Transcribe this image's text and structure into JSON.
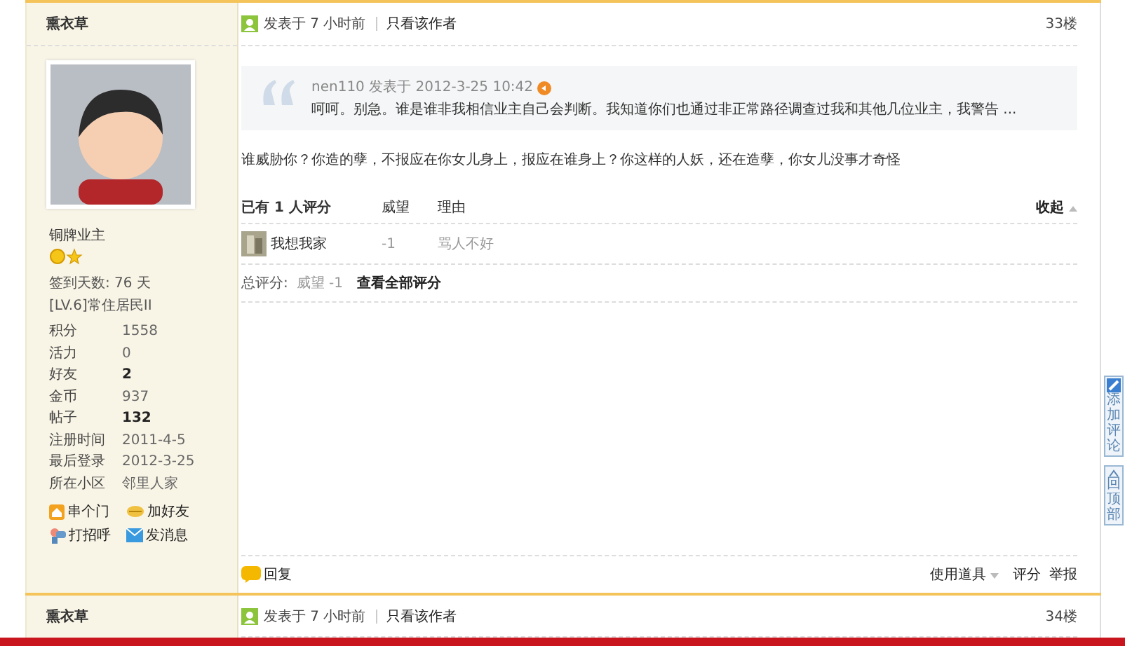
{
  "posts": [
    {
      "author": "熏衣草",
      "rank": "铜牌业主",
      "checkin": "签到天数: 76 天",
      "level": "[LV.6]常住居民II",
      "stats": [
        {
          "label": "积分",
          "value": "1558",
          "bold": false
        },
        {
          "label": "活力",
          "value": "0",
          "bold": false
        },
        {
          "label": "好友",
          "value": "2",
          "bold": true
        },
        {
          "label": "金币",
          "value": "937",
          "bold": false
        },
        {
          "label": "帖子",
          "value": "132",
          "bold": true
        },
        {
          "label": "注册时间",
          "value": "2011-4-5",
          "bold": false
        },
        {
          "label": "最后登录",
          "value": "2012-3-25",
          "bold": false
        },
        {
          "label": "所在小区",
          "value": "邻里人家",
          "bold": false
        }
      ],
      "actions": [
        {
          "kind": "home",
          "label": "串个门"
        },
        {
          "kind": "friend",
          "label": "加好友"
        },
        {
          "kind": "greet",
          "label": "打招呼"
        },
        {
          "kind": "mail",
          "label": "发消息"
        }
      ],
      "posted": "发表于 7 小时前",
      "author_only": "只看该作者",
      "floor": "33楼",
      "quote": {
        "meta": "nen110 发表于 2012-3-25 10:42",
        "text": "呵呵。别急。谁是谁非我相信业主自己会判断。我知道你们也通过非正常路径调查过我和其他几位业主，我警告 ..."
      },
      "message": "谁威胁你？你造的孽，不报应在你女儿身上，报应在谁身上？你这样的人妖，还在造孽，你女儿没事才奇怪",
      "ratings": {
        "title_prefix": "已有",
        "count": "1",
        "title_suffix": "人评分",
        "col_score": "威望",
        "col_reason": "理由",
        "collapse": "收起",
        "rows": [
          {
            "user": "我想我家",
            "score": "-1",
            "reason": "骂人不好"
          }
        ],
        "total_label": "总评分:",
        "total_value": "威望 -1",
        "view_all": "查看全部评分"
      },
      "reply": "回复",
      "tools": "使用道具",
      "rate": "评分",
      "report": "举报"
    },
    {
      "author": "熏衣草",
      "posted": "发表于 7 小时前",
      "author_only": "只看该作者",
      "floor": "34楼"
    }
  ],
  "side_buttons": [
    {
      "kind": "comment",
      "label": "添加评论"
    },
    {
      "kind": "top",
      "label": "回顶部"
    }
  ]
}
